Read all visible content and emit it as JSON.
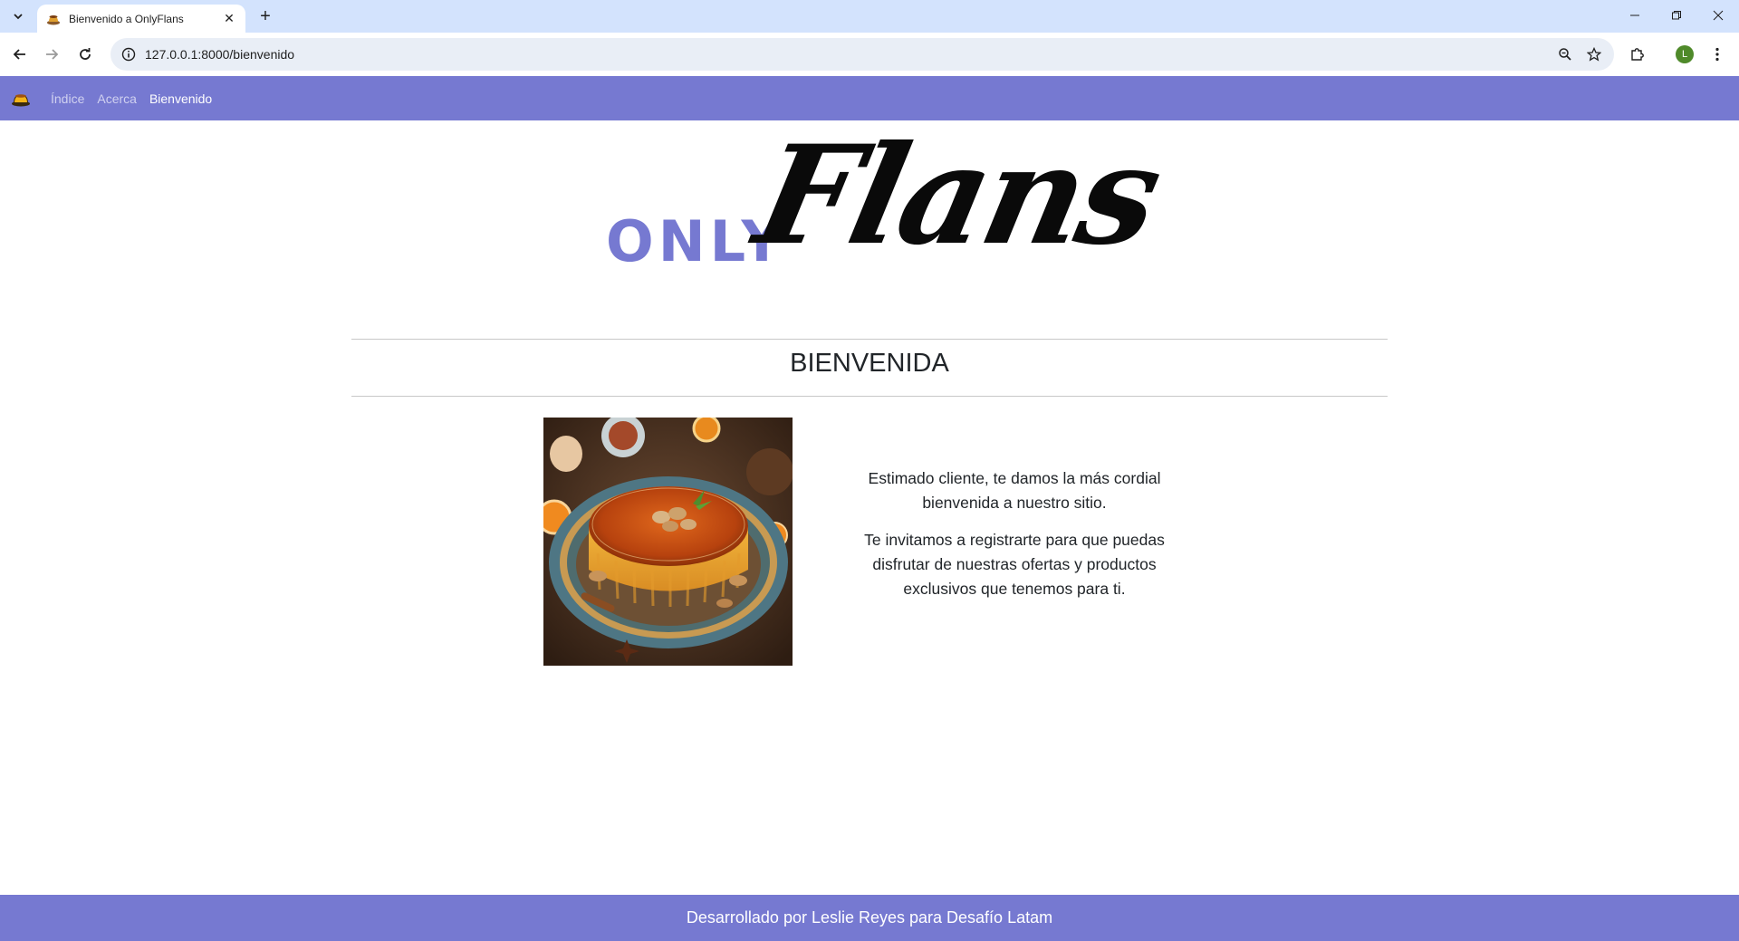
{
  "browser": {
    "tab_title": "Bienvenido a OnlyFlans",
    "url": "127.0.0.1:8000/bienvenido",
    "profile_initial": "L"
  },
  "navbar": {
    "links": [
      {
        "label": "Índice",
        "active": false
      },
      {
        "label": "Acerca",
        "active": false
      },
      {
        "label": "Bienvenido",
        "active": true
      }
    ]
  },
  "logo": {
    "prefix": "ONLY",
    "wordmark": "Flans"
  },
  "main": {
    "title": "BIENVENIDA",
    "paragraph_1": "Estimado cliente, te damos la más cordial bienvenida a nuestro sitio.",
    "paragraph_2": "Te invitamos a registrarte para que puedas disfrutar de nuestras ofertas y productos exclusivos que tenemos para ti."
  },
  "footer": {
    "text": "Desarrollado por Leslie Reyes para Desafío Latam"
  },
  "colors": {
    "brand": "#7679d1",
    "chrome": "#d3e3fd",
    "omnibox": "#e9eef6"
  }
}
